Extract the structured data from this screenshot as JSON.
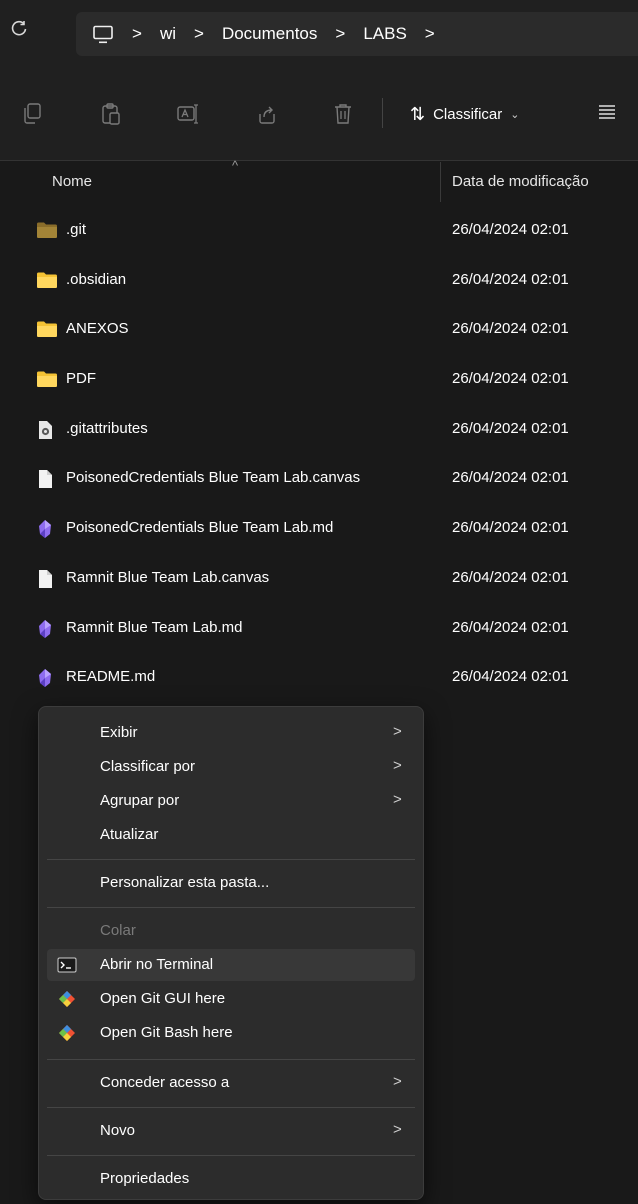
{
  "address_bar": {
    "crumbs": [
      "wi",
      "Documentos",
      "LABS"
    ],
    "separator": ">"
  },
  "toolbar": {
    "sort_label": "Classificar",
    "sort_arrow": "⇅",
    "sort_chevron": "⌄"
  },
  "columns": {
    "name": "Nome",
    "date": "Data de modificação",
    "sort_caret": "^"
  },
  "files": [
    {
      "name": ".git",
      "date": "26/04/2024 02:01",
      "icon": "folder-dark-icon"
    },
    {
      "name": ".obsidian",
      "date": "26/04/2024 02:01",
      "icon": "folder-icon"
    },
    {
      "name": "ANEXOS",
      "date": "26/04/2024 02:01",
      "icon": "folder-icon"
    },
    {
      "name": "PDF",
      "date": "26/04/2024 02:01",
      "icon": "folder-icon"
    },
    {
      "name": ".gitattributes",
      "date": "26/04/2024 02:01",
      "icon": "settings-file-icon"
    },
    {
      "name": "PoisonedCredentials Blue Team Lab.canvas",
      "date": "26/04/2024 02:01",
      "icon": "file-icon"
    },
    {
      "name": "PoisonedCredentials Blue Team Lab.md",
      "date": "26/04/2024 02:01",
      "icon": "obsidian-icon"
    },
    {
      "name": "Ramnit Blue Team Lab.canvas",
      "date": "26/04/2024 02:01",
      "icon": "file-icon"
    },
    {
      "name": "Ramnit Blue Team Lab.md",
      "date": "26/04/2024 02:01",
      "icon": "obsidian-icon"
    },
    {
      "name": "README.md",
      "date": "26/04/2024 02:01",
      "icon": "obsidian-icon"
    }
  ],
  "context_menu": {
    "arrow": ">",
    "items": [
      {
        "label": "Exibir"
      },
      {
        "label": "Classificar por"
      },
      {
        "label": "Agrupar por"
      },
      {
        "label": "Atualizar"
      },
      {
        "label": "Personalizar esta pasta..."
      },
      {
        "label": "Colar"
      },
      {
        "label": "Abrir no Terminal"
      },
      {
        "label": "Open Git GUI here"
      },
      {
        "label": "Open Git Bash here"
      },
      {
        "label": "Conceder acesso a"
      },
      {
        "label": "Novo"
      },
      {
        "label": "Propriedades"
      }
    ]
  },
  "colors": {
    "folder": "#F4C234",
    "folder_dark": "#8A6D2A",
    "obsidian": "#8E6CEF",
    "git": "#F05133"
  }
}
